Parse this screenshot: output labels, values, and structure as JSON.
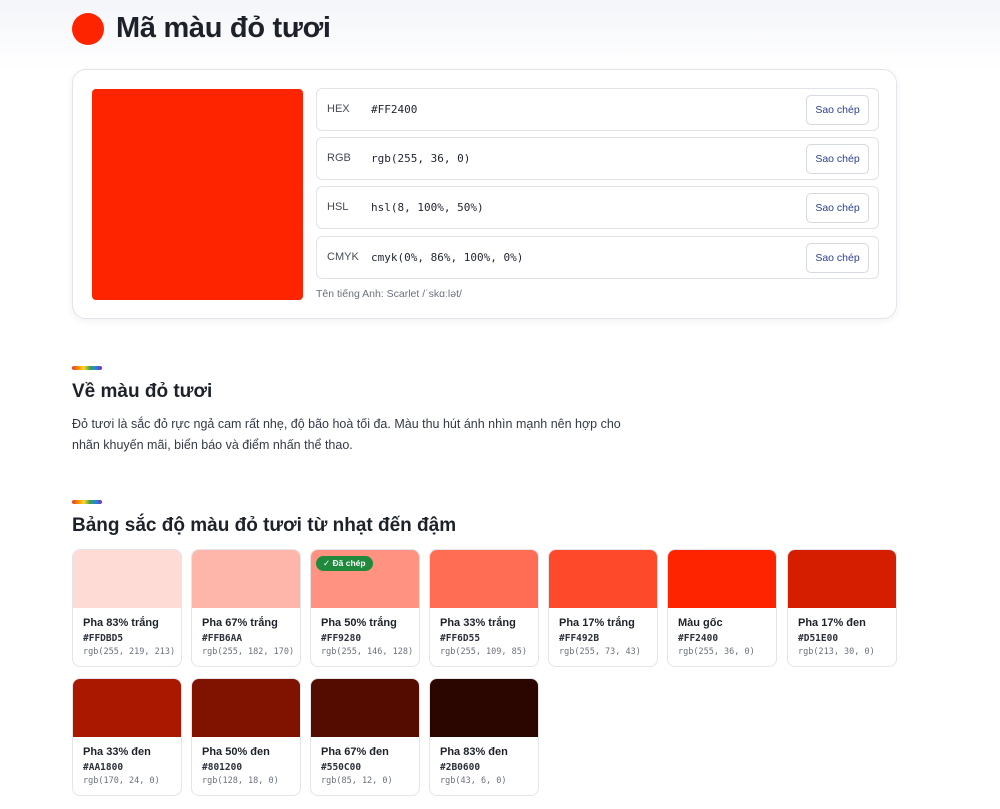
{
  "header": {
    "title": "Mã màu đỏ tươi",
    "dot_color": "#FF2400"
  },
  "color_card": {
    "swatch_color": "#FF2400",
    "codes": [
      {
        "label": "HEX",
        "value": "#FF2400",
        "button": "Sao chép"
      },
      {
        "label": "RGB",
        "value": "rgb(255, 36, 0)",
        "button": "Sao chép"
      },
      {
        "label": "HSL",
        "value": "hsl(8, 100%, 50%)",
        "button": "Sao chép"
      },
      {
        "label": "CMYK",
        "value": "cmyk(0%, 86%, 100%, 0%)",
        "button": "Sao chép"
      }
    ],
    "english_name": "Tên tiếng Anh: Scarlet /ˈskɑːlət/"
  },
  "about": {
    "title": "Về màu đỏ tươi",
    "text": "Đỏ tươi là sắc đỏ rực ngả cam rất nhẹ, độ bão hoà tối đa. Màu thu hút ánh nhìn mạnh nên hợp cho nhãn khuyến mãi, biển báo và điểm nhấn thể thao."
  },
  "shades": {
    "title": "Bảng sắc độ màu đỏ tươi từ nhạt đến đậm",
    "copied_label": "✓ Đã chép",
    "items": [
      {
        "name": "Pha 83% trắng",
        "hex": "#FFDBD5",
        "rgb": "rgb(255, 219, 213)"
      },
      {
        "name": "Pha 67% trắng",
        "hex": "#FFB6AA",
        "rgb": "rgb(255, 182, 170)"
      },
      {
        "name": "Pha 50% trắng",
        "hex": "#FF9280",
        "rgb": "rgb(255, 146, 128)",
        "copied": true
      },
      {
        "name": "Pha 33% trắng",
        "hex": "#FF6D55",
        "rgb": "rgb(255, 109, 85)"
      },
      {
        "name": "Pha 17% trắng",
        "hex": "#FF492B",
        "rgb": "rgb(255, 73, 43)"
      },
      {
        "name": "Màu gốc",
        "hex": "#FF2400",
        "rgb": "rgb(255, 36, 0)"
      },
      {
        "name": "Pha 17% đen",
        "hex": "#D51E00",
        "rgb": "rgb(213, 30, 0)"
      },
      {
        "name": "Pha 33% đen",
        "hex": "#AA1800",
        "rgb": "rgb(170, 24, 0)"
      },
      {
        "name": "Pha 50% đen",
        "hex": "#801200",
        "rgb": "rgb(128, 18, 0)"
      },
      {
        "name": "Pha 67% đen",
        "hex": "#550C00",
        "rgb": "rgb(85, 12, 0)"
      },
      {
        "name": "Pha 83% đen",
        "hex": "#2B0600",
        "rgb": "rgb(43, 6, 0)"
      }
    ]
  }
}
